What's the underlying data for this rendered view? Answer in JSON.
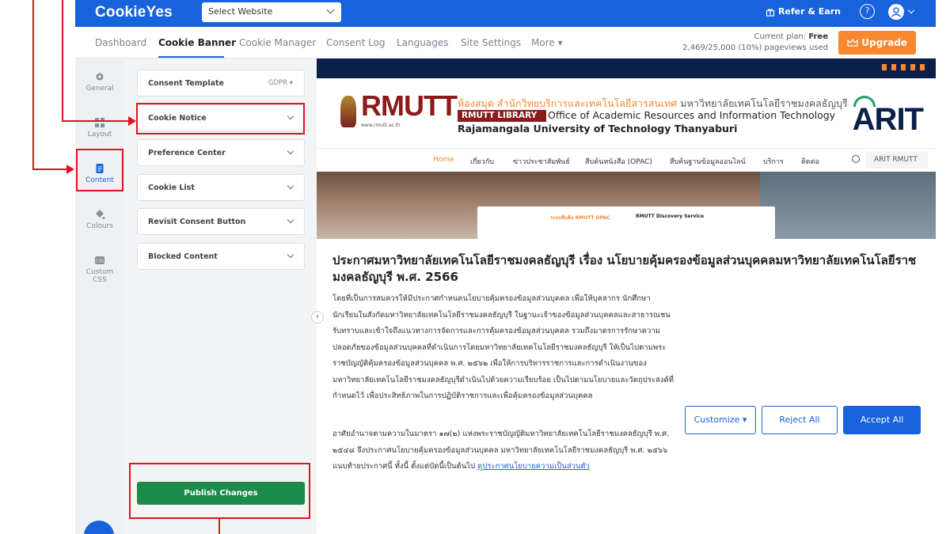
{
  "app": {
    "logo": "CookieYes",
    "site_select_placeholder": "Select Website",
    "refer_label": "Refer & Earn",
    "help_label": "?"
  },
  "nav": {
    "items": [
      "Dashboard",
      "Cookie Banner",
      "Cookie Manager",
      "Consent Log",
      "Languages",
      "Site Settings",
      "More ▾"
    ],
    "active": "Cookie Banner",
    "plan_label": "Current plan:",
    "plan_value": "Free",
    "pageviews": "2,469/25,000 (10%) pageviews used",
    "upgrade_label": "Upgrade"
  },
  "rail": {
    "items": [
      {
        "label": "General",
        "icon": "gear-icon"
      },
      {
        "label": "Layout",
        "icon": "layout-grid-icon"
      },
      {
        "label": "Content",
        "icon": "document-icon"
      },
      {
        "label": "Colours",
        "icon": "paint-bucket-icon"
      },
      {
        "label": "Custom CSS",
        "icon": "css-icon"
      }
    ],
    "active": "Content"
  },
  "panel": {
    "consent_template": {
      "label": "Consent Template",
      "value": "GDPR ▾"
    },
    "sections": [
      "Cookie Notice",
      "Preference Center",
      "Cookie List",
      "Revisit Consent Button",
      "Blocked Content"
    ],
    "publish_label": "Publish Changes"
  },
  "preview": {
    "header": {
      "rmutt": "RMUTT",
      "rmutt_sub": "www.rmutt.ac.th",
      "line1_org": "ห้องสมุด สำนักวิทยบริการและเทคโนโลยีสารสนเทศ",
      "line1_uni": "มหาวิทยาลัยเทคโนโลยีราชมงคลธัญบุรี",
      "library_badge": "RMUTT LIBRARY",
      "line2": "Office of Academic Resources and Information Technology",
      "line3": "Rajamangala University of Technology Thanyaburi",
      "arit": "ARIT"
    },
    "menu": [
      "Home",
      "เกี่ยวกับ",
      "ข่าวประชาสัมพันธ์",
      "สืบค้นหนังสือ (OPAC)",
      "สืบค้นฐานข้อมูลออนไลน์",
      "บริการ",
      "ติดต่อ"
    ],
    "menu_search_text": "ARIT RMUTT",
    "hero_tabs": [
      "ระบบสืบค้น RMUTT OPAC",
      "RMUTT Discovery Service"
    ],
    "banner": {
      "title": "ประกาศมหาวิทยาลัยเทคโนโลยีราชมงคลธัญบุรี เรื่อง นโยบายคุ้มครองข้อมูลส่วนบุคคลมหาวิทยาลัยเทคโนโลยีราชมงคลธัญบุรี พ.ศ. 2566",
      "paragraph1": "โดยที่เป็นการสมควรให้มีประกาศกำหนดนโยบายคุ้มครองข้อมูลส่วนบุคคล เพื่อให้บุคลากร นักศึกษา นักเรียนในสังกัดมหาวิทยาลัยเทคโนโลยีราชมงคลธัญบุรี ในฐานะเจ้าของข้อมูลส่วนบุคคลและสาธารณชนรับทราบและเข้าใจถึงแนวทางการจัดการและการคุ้มครองข้อมูลส่วนบุคคล รวมถึงมาตรการรักษาความปลอดภัยของข้อมูลส่วนบุคคลที่ดำเนินการโดยมหาวิทยาลัยเทคโนโลยีราชมงคลธัญบุรี ให้เป็นไปตามพระราชบัญญัติคุ้มครองข้อมูลส่วนบุคคล พ.ศ. ๒๕๖๒ เพื่อให้การบริหารราชการและการดำเนินงานของมหาวิทยาลัยเทคโนโลยีราชมงคลธัญบุรีดำเนินไปด้วยความเรียบร้อย เป็นไปตามนโยบายและวัตถุประสงค์ที่กำหนดไว้ เพื่อประสิทธิภาพในการปฏิบัติราชการและเพื่อคุ้มครองข้อมูลส่วนบุคคล",
      "paragraph2": "อาศัยอำนาจตามความในมาตรา ๑๗(๒) แห่งพระราชบัญญัติมหาวิทยาลัยเทคโนโลยีราชมงคลธัญบุรี พ.ศ. ๒๕๔๘ จึงประกาศนโยบายคุ้มครองข้อมูลส่วนบุคคล มหาวิทยาลัยเทคโนโลยีราชมงคลธัญบุรี พ.ศ. ๒๕๖๖ แนบท้ายประกาศนี้ ทั้งนี้ ตั้งแต่บัดนี้เป็นต้นไป",
      "link": "ดูประกาศนโยบายความเป็นส่วนตัว",
      "customize_label": "Customize ▾",
      "reject_label": "Reject All",
      "accept_label": "Accept All"
    }
  },
  "colors": {
    "brand_blue": "#1863dc",
    "upgrade_orange": "#f7882f",
    "publish_green": "#1b8a4a",
    "annotation_red": "#e0121f"
  }
}
